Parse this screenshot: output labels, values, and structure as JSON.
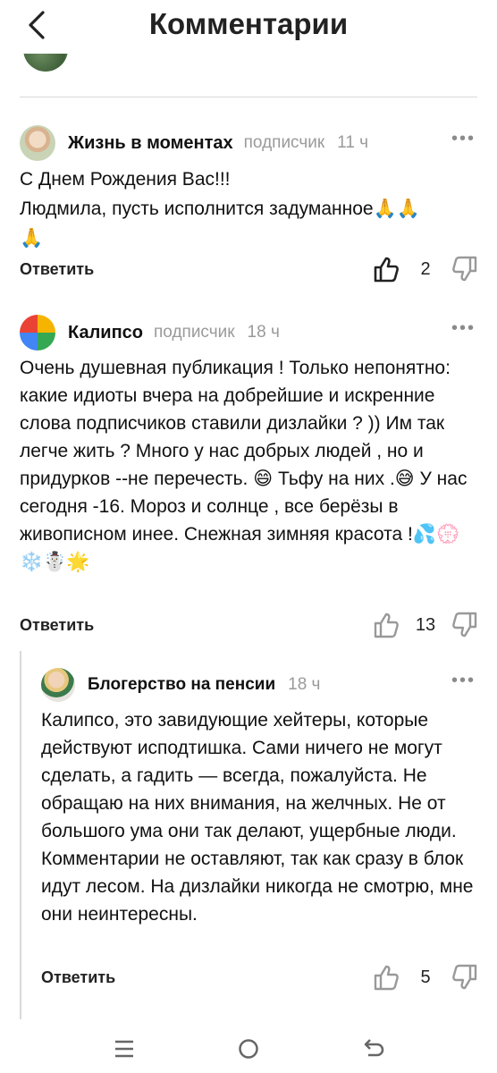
{
  "header": {
    "title": "Комментарии",
    "back_icon": "chevron-left-icon"
  },
  "comments": [
    {
      "author": "Жизнь в моментах",
      "badge": "подписчик",
      "time": "11 ч",
      "text": "С Днем Рождения Вас!!!\nЛюдмила, пусть исполнится задуманное🙏🙏\n🙏",
      "reply_label": "Ответить",
      "likes": "2"
    },
    {
      "author": "Калипсо",
      "badge": "подписчик",
      "time": "18 ч",
      "text": "Очень душевная публикация !  Только непонятно:  какие идиоты  вчера на добрейшие и    искренние   слова подписчиков  ставили дизлайки ?  ))  Им так легче жить ?   Много у нас добрых людей  ,  но и  придурков  --не перечесть.   😄  Тьфу на них .😅  У нас сегодня -16. Мороз и солнце  ,  все берёзы в живописном инее.  Снежная зимняя красота !💦💮❄️☃️🌟",
      "reply_label": "Ответить",
      "likes": "13"
    },
    {
      "author": "Блогерство на пенсии",
      "badge": "",
      "time": "18 ч",
      "text": "Калипсо, это завидующие хейтеры, которые действуют исподтишка. Сами ничего не могут сделать, а гадить — всегда, пожалуйста. Не обращаю на них внимания, на желчных. Не от большого ума они так делают, ущербные люди. Комментарии не оставляют, так как сразу в блок идут лесом. На дизлайки никогда не смотрю, мне они неинтересны.",
      "reply_label": "Ответить",
      "likes": "5"
    }
  ],
  "more_icon": "•••",
  "nav": {
    "recent_icon": "menu-lines-icon",
    "home_icon": "home-circle-icon",
    "back_icon": "back-arrow-icon"
  }
}
